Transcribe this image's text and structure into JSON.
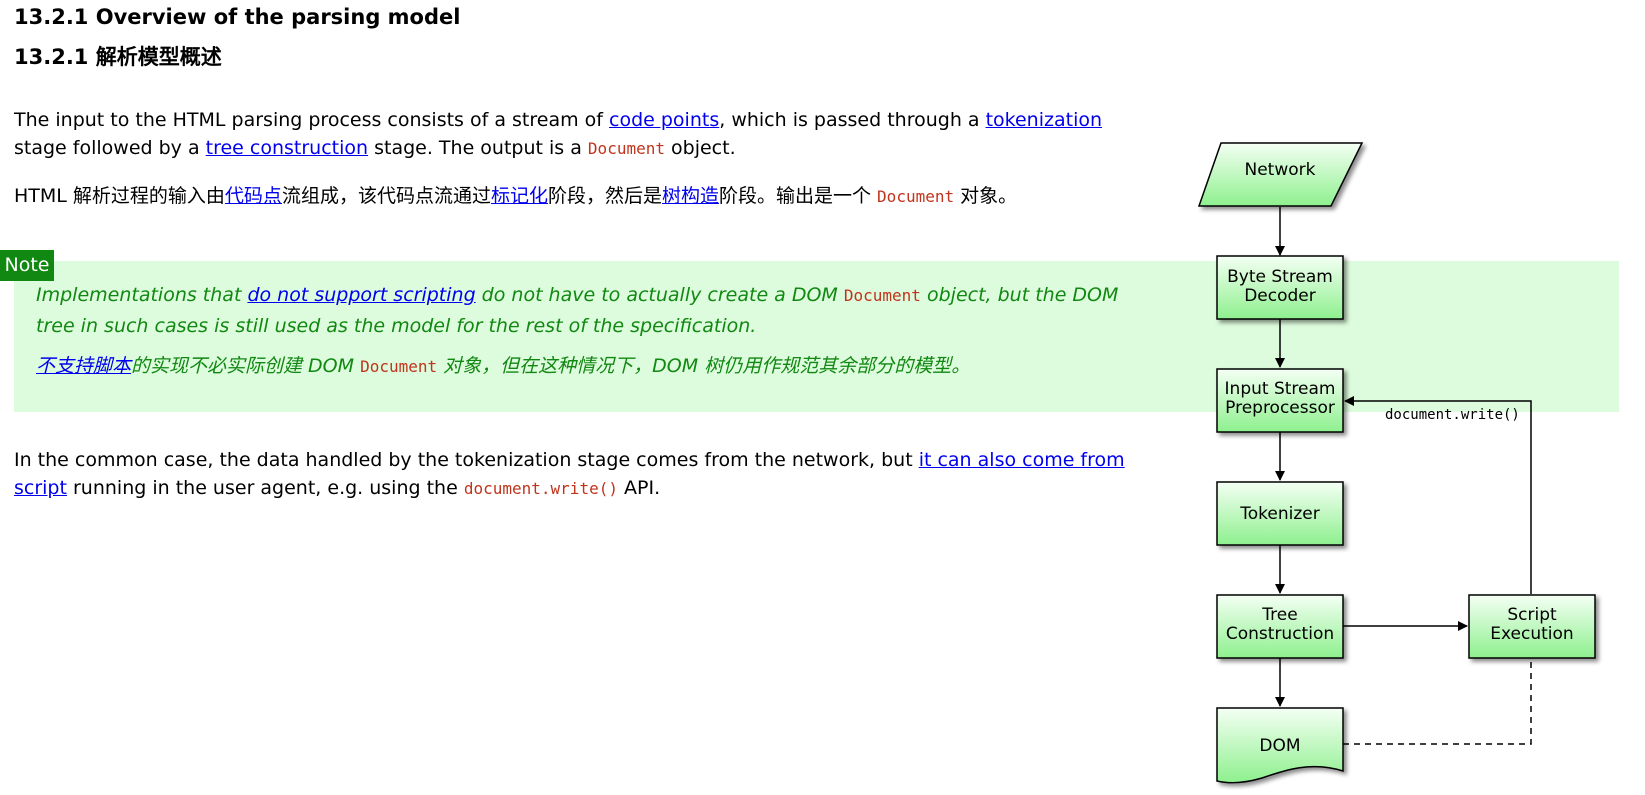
{
  "heading_en": "13.2.1 Overview of the parsing model",
  "heading_zh": "13.2.1 解析模型概述",
  "para1_en": {
    "t1": "The input to the HTML parsing process consists of a stream of ",
    "link1": "code points",
    "t2": ", which is passed through a ",
    "link2": "tokenization",
    "t3": " stage followed by a ",
    "link3": "tree construction",
    "t4": " stage. The output is a ",
    "code1": "Document",
    "t5": " object."
  },
  "para1_zh": {
    "t1": "HTML 解析过程的输入由",
    "link1": "代码点",
    "t2": "流组成，该代码点流通过",
    "link2": "标记化",
    "t3": "阶段，然后是",
    "link3": "树构造",
    "t4": "阶段。输出是一个 ",
    "code1": "Document",
    "t5": " 对象。"
  },
  "note": {
    "label": "Note",
    "en_t1": "Implementations that ",
    "en_link": "do not support scripting",
    "en_t2": " do not have to actually create a DOM ",
    "en_code": "Document",
    "en_t3": " object, but the DOM tree in such cases is still used as the model for the rest of the specification.",
    "zh_link": "不支持脚本",
    "zh_t1": "的实现不必实际创建 DOM ",
    "zh_code": "Document",
    "zh_t2": " 对象，但在这种情况下，DOM 树仍用作规范其余部分的模型。"
  },
  "para2": {
    "t1": "In the common case, the data handled by the tokenization stage comes from the network, but ",
    "link1": "it can also come from script",
    "t2": " running in the user agent, e.g. using the ",
    "code1": "document.write()",
    "t3": " API."
  },
  "diagram": {
    "network": "Network",
    "byte_stream_1": "Byte Stream",
    "byte_stream_2": "Decoder",
    "input_stream_1": "Input Stream",
    "input_stream_2": "Preprocessor",
    "tokenizer": "Tokenizer",
    "tree_1": "Tree",
    "tree_2": "Construction",
    "script_1": "Script",
    "script_2": "Execution",
    "dom": "DOM",
    "doc_write": "document.write()"
  },
  "colors": {
    "link": "#0000ee",
    "code": "#c0341d",
    "note_bg": "#ddfbdd",
    "note_accent": "#118811",
    "box_fill_top": "#f4fff4",
    "box_fill_bottom": "#8ef08e"
  }
}
